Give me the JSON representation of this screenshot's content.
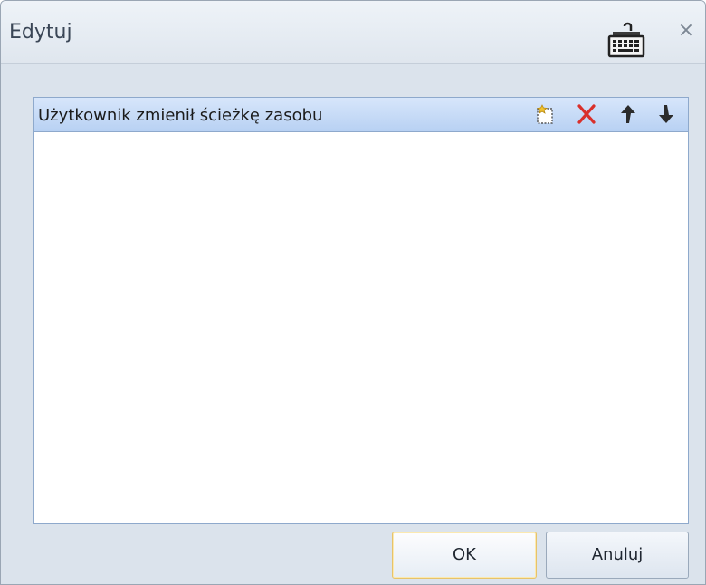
{
  "window": {
    "title": "Edytuj",
    "icons": {
      "keyboard": "keyboard-icon",
      "close": "close-icon"
    },
    "close_glyph": "×"
  },
  "list": {
    "header_label": "Użytkownik zmienił ścieżkę zasobu",
    "toolbar": {
      "new": "new-item-icon",
      "delete": "delete-icon",
      "move_up": "arrow-up-icon",
      "move_down": "arrow-down-icon"
    },
    "items": []
  },
  "buttons": {
    "ok": "OK",
    "cancel": "Anuluj"
  },
  "colors": {
    "header_bg": "#c9dcf7",
    "delete": "#d9302b",
    "ok_border": "#e7c36a"
  }
}
